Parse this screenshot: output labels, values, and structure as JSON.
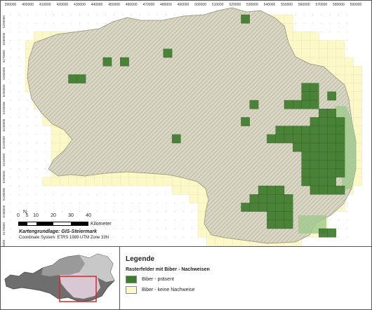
{
  "map": {
    "x_ticks": [
      "390000",
      "400000",
      "410000",
      "420000",
      "430000",
      "440000",
      "450000",
      "460000",
      "470000",
      "480000",
      "490000",
      "500000",
      "510000",
      "520000",
      "530000",
      "540000",
      "550000",
      "560000",
      "570000",
      "580000",
      "590000"
    ],
    "y_ticks": [
      "5290000",
      "5280000",
      "5270000",
      "5260000",
      "5250000",
      "5240000",
      "5230000",
      "5220000",
      "5210000",
      "5200000",
      "5190000",
      "5180000",
      "5170000",
      "5160000"
    ],
    "colors": {
      "terrain": "#d9d7c3",
      "terrain_shadow": "#b9b7a2",
      "grid_empty": "#fcf8c8",
      "grid_present": "#3f7b2e",
      "grid_light_green": "#9fc98b",
      "frame": "#555555"
    }
  },
  "scale": {
    "numbers": [
      "0",
      "5",
      "10",
      "20",
      "30",
      "40"
    ],
    "unit": "Kilometer",
    "north": "N",
    "credit": "Kartengrundlage: GIS-Steiermark",
    "coordinate_system": "Coordinate System: ETRS 1989 UTM Zone 33N"
  },
  "legend": {
    "title": "Legende",
    "subtitle": "Rasterfelder mit Biber - Nachweisen",
    "items": [
      {
        "label": "Biber - präsent",
        "color": "#3f7b2e"
      },
      {
        "label": "Biber - keine Nachweise",
        "color": "#fcf8c8"
      }
    ]
  },
  "inset": {
    "colors": {
      "austria_dark": "#6e6e6e",
      "austria_mid": "#9a9a9a",
      "austria_light": "#c8c8c8",
      "styria_pink": "#d9c7d4",
      "highlight_box": "#d62828"
    }
  }
}
